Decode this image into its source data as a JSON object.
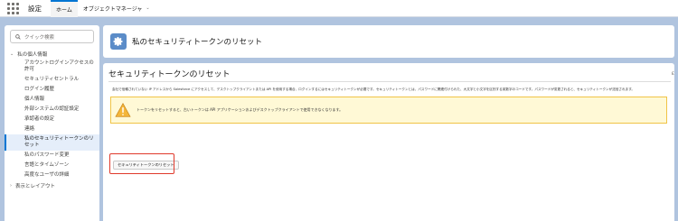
{
  "app": {
    "name": "設定",
    "tabs": [
      {
        "label": "ホーム"
      },
      {
        "label": "オブジェクトマネージャ"
      }
    ]
  },
  "sidebar": {
    "search_placeholder": "クイック検索",
    "groups": [
      {
        "label": "私の個人情報",
        "expanded": true
      },
      {
        "label": "表示とレイアウト",
        "expanded": false
      }
    ],
    "items": [
      {
        "label": "アカウントログインアクセスの許可"
      },
      {
        "label": "セキュリティセントラル"
      },
      {
        "label": "ログイン履歴"
      },
      {
        "label": "個人情報"
      },
      {
        "label": "外部システムの認証設定"
      },
      {
        "label": "承認者の設定"
      },
      {
        "label": "連絡"
      },
      {
        "label": "私のセキュリティトークンのリセット",
        "selected": true
      },
      {
        "label": "私のパスワード変更"
      },
      {
        "label": "言語とタイムゾーン"
      },
      {
        "label": "高度なユーザの詳細"
      }
    ]
  },
  "header": {
    "icon": "gear-icon",
    "title": "私のセキュリティトークンのリセット"
  },
  "content": {
    "title": "セキュリティトークンのリセット",
    "description": "会社で信頼されていない IP アドレスから Salesforce にアクセスして、デスクトップクライアントまたは API を使用する場合、ログインするにはセキュリティトークンが必要です。セキュリティトークンとは、パスワードに関連付けられた、大文字と小文字を区別する英数字のコードです。パスワードが変更されると、セキュリティトークンが送信されます。",
    "warning": "トークンをリセットすると、古いトークンは API アプリケーションおよびデスクトップクライアントで使用できなくなります。",
    "button_label": "セキュリティトークンのリセット",
    "edge_mark": "ε"
  },
  "colors": {
    "brand": "#0176d3",
    "background": "#b0c4df",
    "highlight": "#e0392b",
    "warning_bg": "#fff9d6"
  }
}
